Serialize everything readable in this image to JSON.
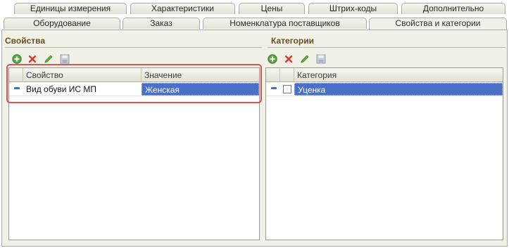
{
  "tabs_row1": [
    {
      "label": "Единицы измерения"
    },
    {
      "label": "Характеристики"
    },
    {
      "label": "Цены"
    },
    {
      "label": "Штрих-коды"
    },
    {
      "label": "Дополнительно"
    }
  ],
  "tabs_row2": [
    {
      "label": "Оборудование"
    },
    {
      "label": "Заказ"
    },
    {
      "label": "Номенклатура поставщиков"
    },
    {
      "label": "Свойства и категории",
      "active": true
    }
  ],
  "properties": {
    "title": "Свойства",
    "toolbar": [
      "add-icon",
      "delete-icon",
      "edit-icon",
      "save-icon"
    ],
    "columns": [
      "Свойство",
      "Значение"
    ],
    "rows": [
      {
        "property": "Вид обуви ИС МП",
        "value": "Женская"
      }
    ]
  },
  "categories": {
    "title": "Категории",
    "toolbar": [
      "add-icon",
      "delete-icon",
      "edit-icon",
      "save-icon"
    ],
    "columns": [
      "Категория"
    ],
    "rows": [
      {
        "checked": false,
        "category": "Уценка"
      }
    ]
  },
  "colors": {
    "selection": "#4a6fc4",
    "section_title": "#6b4c1d",
    "highlight": "#d9534f"
  }
}
